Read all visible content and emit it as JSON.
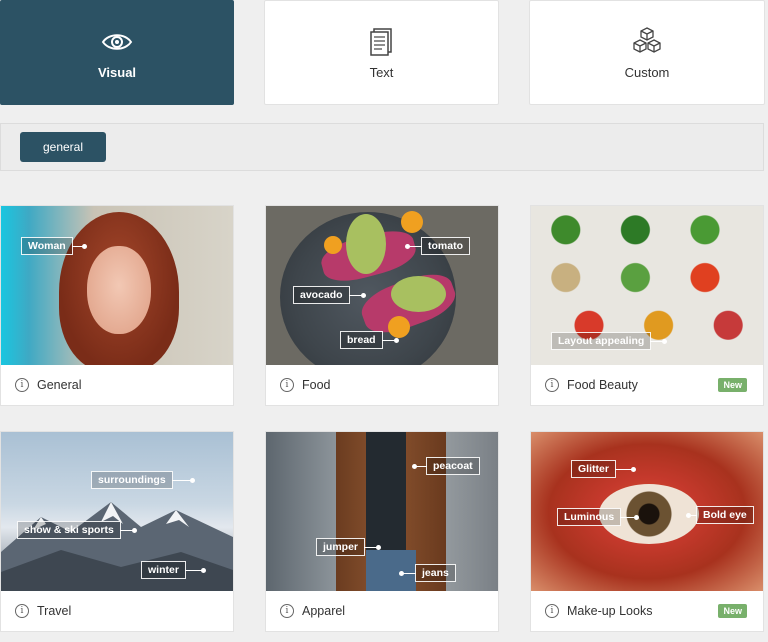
{
  "tabs": [
    {
      "label": "Visual",
      "icon": "eye-icon",
      "active": true
    },
    {
      "label": "Text",
      "icon": "document-icon",
      "active": false
    },
    {
      "label": "Custom",
      "icon": "cubes-icon",
      "active": false
    }
  ],
  "filter": {
    "chip_label": "general"
  },
  "cards": [
    {
      "title": "General",
      "tags": [
        "Woman"
      ],
      "badge": ""
    },
    {
      "title": "Food",
      "tags": [
        "tomato",
        "avocado",
        "bread"
      ],
      "badge": ""
    },
    {
      "title": "Food Beauty",
      "tags": [
        "Layout appealing"
      ],
      "badge": "New"
    },
    {
      "title": "Travel",
      "tags": [
        "surroundings",
        "show & ski sports",
        "winter"
      ],
      "badge": ""
    },
    {
      "title": "Apparel",
      "tags": [
        "peacoat",
        "jumper",
        "jeans"
      ],
      "badge": ""
    },
    {
      "title": "Make-up Looks",
      "tags": [
        "Glitter",
        "Luminous",
        "Bold eye"
      ],
      "badge": "New"
    }
  ],
  "colors": {
    "accent": "#2c5264",
    "badge": "#78b06b",
    "background": "#efefef"
  }
}
